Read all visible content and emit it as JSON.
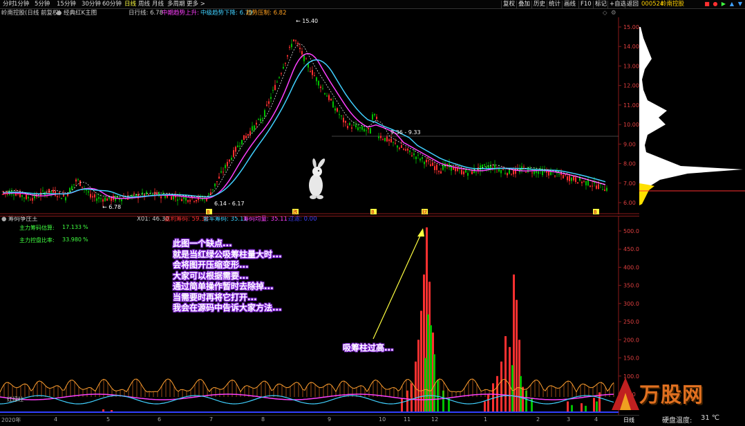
{
  "toolbar": {
    "periods": [
      "分时",
      "1分钟",
      "5分钟",
      "15分钟",
      "30分钟",
      "60分钟",
      "日线",
      "周线",
      "月线",
      "多周期",
      "更多 >"
    ],
    "active_period": "日线",
    "right_buttons": [
      "复权",
      "叠加",
      "历史",
      "统计",
      "画线",
      "F10",
      "标记",
      "+自选",
      "返回"
    ]
  },
  "stock": {
    "code": "000524",
    "name": "岭南控股"
  },
  "title": {
    "name": "岭南控股(日线 前复权)",
    "indicator": "经典红K主图",
    "daily_label": "日行线: 6.78",
    "line2": "中期趋势上升:",
    "line3": "中级趋势下降: 6.79",
    "line4": "趋势压制: 6.82"
  },
  "price_axis": [
    "15.00",
    "14.00",
    "13.00",
    "12.00",
    "11.00",
    "10.00",
    "9.00",
    "8.00",
    "7.00",
    "6.00"
  ],
  "annotations": {
    "high": "← 15.40",
    "low1": "← 6.78",
    "low2": "6.14 - 6.17",
    "mid": "9.36 - 9.33",
    "left_price": "24"
  },
  "markers": [
    {
      "label": "B"
    },
    {
      "label": "跌"
    },
    {
      "label": "B"
    },
    {
      "label": "财"
    },
    {
      "label": "B"
    }
  ],
  "sub": {
    "title": "筹码争庄王",
    "legend": [
      "X01: 46.30",
      "盈利筹码: 59.38",
      "套牢筹码: 35.11",
      "筹码均量: 35.11",
      "过滤: 0.00"
    ],
    "fund_in_label": "主力筹码估算:",
    "fund_in_value": "17.133",
    "fund_in_unit": "%",
    "fund_ratio_label": "主力控盘比率:",
    "fund_ratio_value": "33.980",
    "fund_ratio_unit": "%",
    "axis": [
      "500.0",
      "450.0",
      "400.0",
      "350.0",
      "300.0",
      "250.0",
      "200.0",
      "150.0",
      "100.0",
      "50.0"
    ],
    "bottom_left_label": "红绿柱"
  },
  "note_lines": [
    "此图一个缺点...",
    "就是当红绿公吸筹柱量大时...",
    "会将图开压缩变形...",
    "大家可以根据需要...",
    "通过简单操作暂时去除掉...",
    "当需要时再将它打开...",
    "我会在源码中告诉大家方法..."
  ],
  "note2": "吸筹柱过高...",
  "dates": [
    "2020年",
    "4",
    "5",
    "6",
    "7",
    "8",
    "9",
    "10",
    "11",
    "12",
    "1",
    "2",
    "3",
    "4"
  ],
  "status": {
    "tab": "日线",
    "temp_label": "硬盘温度:",
    "temp_value": "31 ℃"
  },
  "watermark": "万股网",
  "colors": {
    "up": "#ff3030",
    "down": "#00c000",
    "ma_cyan": "#40d0ff",
    "ma_magenta": "#ff40ff",
    "accent": "#ffff40",
    "note_glow": "#8a2be2"
  }
}
